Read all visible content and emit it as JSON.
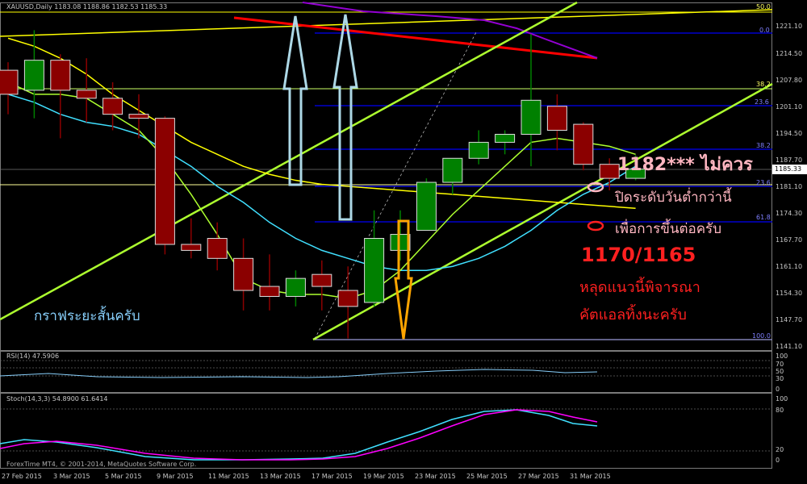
{
  "header": {
    "symbol_line": "XAUUSD,Daily 1183.08 1188.86 1182.53 1185.33"
  },
  "price_axis": [
    "1221.10",
    "1214.50",
    "1207.80",
    "1201.10",
    "1194.50",
    "1187.70",
    "1181.10",
    "1174.30",
    "1167.70",
    "1161.10",
    "1154.30",
    "1147.70",
    "1141.10"
  ],
  "current_price": "1185.33",
  "fib_levels": [
    "50.0",
    "0.0",
    "38.2",
    "23.6",
    "38.2",
    "23.6",
    "61.8",
    "100.0"
  ],
  "rsi": {
    "header": "RSI(14) 47.5906",
    "axis": [
      "100",
      "70",
      "50",
      "30",
      "0"
    ]
  },
  "stoch": {
    "header": "Stoch(14,3,3) 54.8900 61.6414",
    "axis": [
      "100",
      "80",
      "20",
      "0"
    ]
  },
  "time_axis": [
    "27 Feb 2015",
    "3 Mar 2015",
    "5 Mar 2015",
    "9 Mar 2015",
    "11 Mar 2015",
    "13 Mar 2015",
    "17 Mar 2015",
    "19 Mar 2015",
    "23 Mar 2015",
    "25 Mar 2015",
    "27 Mar 2015",
    "31 Mar 2015"
  ],
  "copyright": "ForexTime MT4, © 2001-2014, MetaQuotes Software Corp.",
  "annotations": {
    "left_label": "กราฟระยะสั้นครับ",
    "right_price": "1182*** ไม่ควร",
    "right_line2": "ปิดระดับวันต่ำกว่านี้",
    "right_line3": "เพื่อการขึ้นต่อครับ",
    "support_price": "1170/1165",
    "support_line2": "หลุดแนวนี้พิจารณา",
    "support_line3": "คัตแอลทิ้งนะครับ"
  },
  "colors": {
    "bull": "#008000",
    "bear": "#8b0000",
    "trend": "#adff2f",
    "fib": "#0000cd",
    "ma_yellow": "#ffff00",
    "ma_cyan": "#40e0ff",
    "ma_purple": "#9400d3",
    "ma_red": "#ff0000",
    "arrow_blue": "#add8e6",
    "arrow_orange": "#ffa500",
    "anno_pink": "#ffb6c1",
    "anno_red": "#ff2020",
    "anno_lightblue": "#87cefa",
    "stoch_main": "#40e0ff",
    "stoch_signal": "#ff00ff"
  },
  "chart_data": {
    "type": "candlestick",
    "symbol": "XAUUSD",
    "timeframe": "Daily",
    "ylim": [
      1141.1,
      1225.0
    ],
    "candles": [
      {
        "o": 1210.0,
        "h": 1212.0,
        "c": 1204.0,
        "l": 1199.0
      },
      {
        "o": 1205.0,
        "h": 1220.0,
        "c": 1212.5,
        "l": 1198.0
      },
      {
        "o": 1212.5,
        "h": 1214.0,
        "c": 1205.0,
        "l": 1193.0
      },
      {
        "o": 1205.0,
        "h": 1213.0,
        "c": 1203.0,
        "l": 1197.0
      },
      {
        "o": 1203.0,
        "h": 1207.0,
        "c": 1199.0,
        "l": 1195.0
      },
      {
        "o": 1199.0,
        "h": 1204.0,
        "c": 1198.0,
        "l": 1193.0
      },
      {
        "o": 1198.0,
        "h": 1198.5,
        "c": 1166.5,
        "l": 1164.0
      },
      {
        "o": 1166.5,
        "h": 1173.0,
        "c": 1165.0,
        "l": 1163.0
      },
      {
        "o": 1168.0,
        "h": 1172.0,
        "c": 1163.0,
        "l": 1160.0
      },
      {
        "o": 1163.0,
        "h": 1168.0,
        "c": 1155.0,
        "l": 1150.0
      },
      {
        "o": 1156.0,
        "h": 1164.0,
        "c": 1153.5,
        "l": 1150.0
      },
      {
        "o": 1153.5,
        "h": 1160.0,
        "c": 1158.0,
        "l": 1151.0
      },
      {
        "o": 1159.0,
        "h": 1162.5,
        "c": 1156.0,
        "l": 1150.0
      },
      {
        "o": 1155.0,
        "h": 1161.0,
        "c": 1151.0,
        "l": 1143.0
      },
      {
        "o": 1152.0,
        "h": 1175.0,
        "c": 1168.0,
        "l": 1151.0
      },
      {
        "o": 1165.0,
        "h": 1175.0,
        "c": 1169.0,
        "l": 1162.5
      },
      {
        "o": 1170.0,
        "h": 1183.0,
        "c": 1182.0,
        "l": 1170.0
      },
      {
        "o": 1182.0,
        "h": 1186.0,
        "c": 1188.0,
        "l": 1179.0
      },
      {
        "o": 1188.0,
        "h": 1195.0,
        "c": 1192.0,
        "l": 1186.5
      },
      {
        "o": 1192.0,
        "h": 1195.0,
        "c": 1194.0,
        "l": 1189.0
      },
      {
        "o": 1194.0,
        "h": 1219.0,
        "c": 1202.5,
        "l": 1186.0
      },
      {
        "o": 1201.0,
        "h": 1204.0,
        "c": 1195.0,
        "l": 1190.0
      },
      {
        "o": 1196.5,
        "h": 1197.0,
        "c": 1186.5,
        "l": 1185.0
      },
      {
        "o": 1186.5,
        "h": 1188.0,
        "c": 1183.0,
        "l": 1180.0
      },
      {
        "o": 1183.0,
        "h": 1188.8,
        "c": 1185.3,
        "l": 1182.5
      }
    ],
    "series": [
      {
        "name": "ma_yellow",
        "color": "#ffff00",
        "values": [
          1218,
          1216,
          1213,
          1209,
          1204,
          1200,
          1196,
          1192,
          1189,
          1186,
          1184,
          1182.5,
          1181.5,
          1181,
          1180.5,
          1180,
          1179.5,
          1179,
          1178.5,
          1178,
          1177.5,
          1177,
          1176.5,
          1176,
          1175.5
        ]
      },
      {
        "name": "ma_cyan",
        "color": "#40e0ff",
        "values": [
          1204,
          1202,
          1199,
          1197,
          1196,
          1194,
          1190,
          1186,
          1181,
          1177,
          1172,
          1168,
          1165,
          1163,
          1161,
          1160,
          1160,
          1161,
          1163,
          1166,
          1170,
          1175,
          1179,
          1182,
          1186
        ]
      },
      {
        "name": "ma_lime",
        "color": "#adff2f",
        "values": [
          1207,
          1204,
          1204,
          1203,
          1199,
          1195,
          1188,
          1179,
          1169,
          1158,
          1155,
          1154,
          1154,
          1153,
          1155,
          1160,
          1167,
          1174,
          1180,
          1186,
          1192,
          1193,
          1192,
          1191,
          1189
        ]
      }
    ]
  }
}
